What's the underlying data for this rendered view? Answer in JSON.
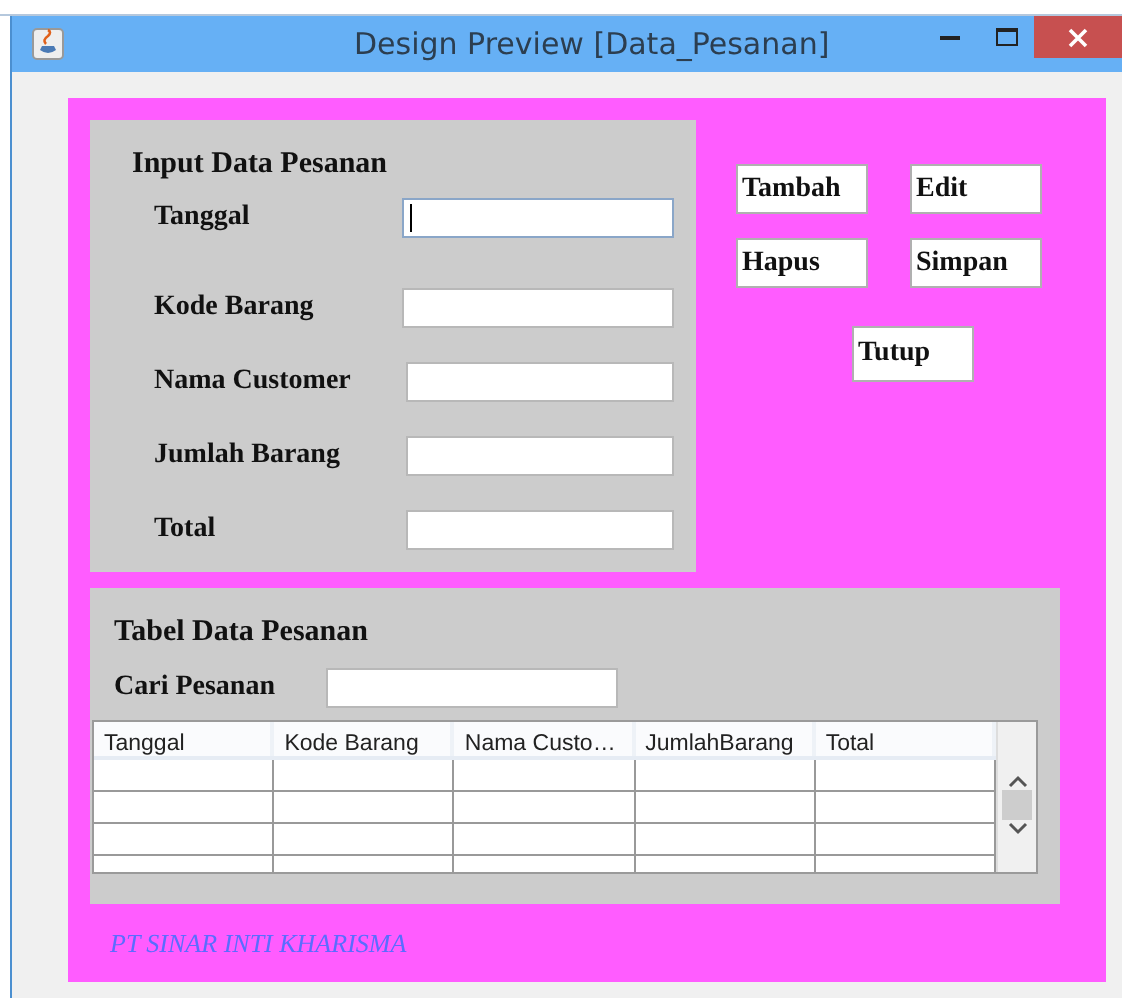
{
  "window": {
    "title": "Design Preview [Data_Pesanan]"
  },
  "input_panel": {
    "title": "Input Data Pesanan",
    "fields": [
      {
        "label": "Tanggal",
        "focused": true
      },
      {
        "label": "Kode Barang",
        "focused": false
      },
      {
        "label": "Nama Customer",
        "focused": false
      },
      {
        "label": "Jumlah Barang",
        "focused": false
      },
      {
        "label": "Total",
        "focused": false
      }
    ]
  },
  "buttons": [
    "Tambah",
    "Edit",
    "Hapus",
    "Simpan",
    "Tutup"
  ],
  "table_panel": {
    "title": "Tabel Data Pesanan",
    "search": {
      "label": "Cari Pesanan"
    },
    "columns": [
      "Tanggal",
      "Kode Barang",
      "Nama Custo…",
      "JumlahBarang",
      "Total"
    ]
  },
  "footer": "PT SINAR INTI KHARISMA"
}
